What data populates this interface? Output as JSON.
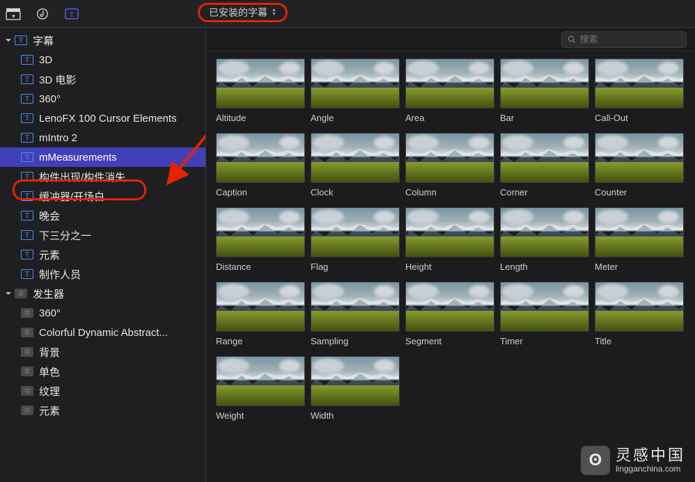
{
  "toolbar": {
    "dropdown_label": "已安装的字幕"
  },
  "search": {
    "placeholder": "搜索"
  },
  "sidebar": {
    "groups": [
      {
        "label": "字幕",
        "icon": "T",
        "children": [
          {
            "label": "3D"
          },
          {
            "label": "3D 电影"
          },
          {
            "label": "360°"
          },
          {
            "label": "LenoFX 100 Cursor Elements"
          },
          {
            "label": "mIntro 2"
          },
          {
            "label": "mMeasurements",
            "selected": true
          },
          {
            "label": "构件出现/构件消失"
          },
          {
            "label": "缓冲器/开场白"
          },
          {
            "label": "晚会"
          },
          {
            "label": "下三分之一"
          },
          {
            "label": "元素"
          },
          {
            "label": "制作人员"
          }
        ]
      },
      {
        "label": "发生器",
        "icon": "G",
        "children": [
          {
            "label": "360°"
          },
          {
            "label": "Colorful Dynamic Abstract..."
          },
          {
            "label": "背景"
          },
          {
            "label": "单色"
          },
          {
            "label": "纹理"
          },
          {
            "label": "元素"
          }
        ]
      }
    ]
  },
  "grid_items": [
    {
      "label": "Altitude"
    },
    {
      "label": "Angle"
    },
    {
      "label": "Area"
    },
    {
      "label": "Bar"
    },
    {
      "label": "Call-Out"
    },
    {
      "label": "Caption"
    },
    {
      "label": "Clock"
    },
    {
      "label": "Column"
    },
    {
      "label": "Corner"
    },
    {
      "label": "Counter"
    },
    {
      "label": "Distance"
    },
    {
      "label": "Flag"
    },
    {
      "label": "Height"
    },
    {
      "label": "Length"
    },
    {
      "label": "Meter"
    },
    {
      "label": "Range"
    },
    {
      "label": "Sampling"
    },
    {
      "label": "Segment"
    },
    {
      "label": "Timer"
    },
    {
      "label": "Title"
    },
    {
      "label": "Weight"
    },
    {
      "label": "Width"
    }
  ],
  "watermark": {
    "cn": "灵感中国",
    "en": "lingganchina.com"
  }
}
